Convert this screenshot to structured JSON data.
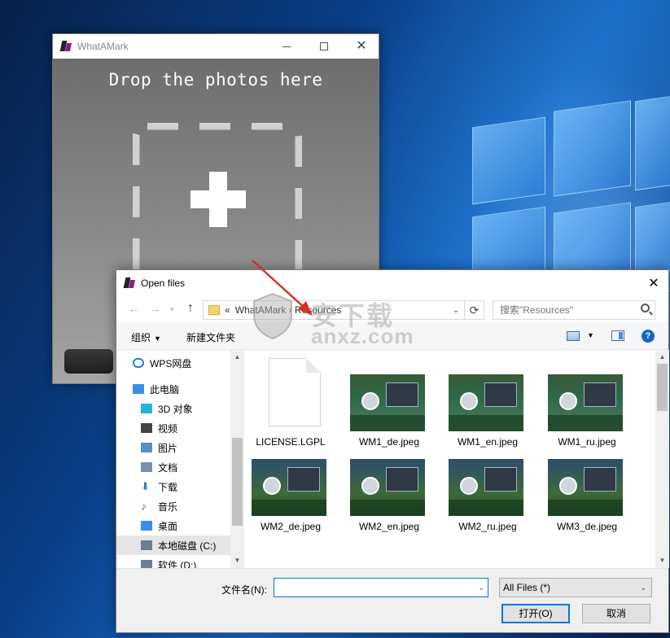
{
  "whatamark": {
    "title": "WhatAMark",
    "drop_label": "Drop the photos here"
  },
  "dialog": {
    "title": "Open files",
    "address": {
      "prefix": "«",
      "path": [
        "WhatAMark",
        "Resources"
      ],
      "path_text": "WhatAMark  ›  Resources"
    },
    "search_placeholder": "搜索\"Resources\"",
    "toolbar": {
      "organize": "组织",
      "new_folder": "新建文件夹"
    },
    "sidebar": [
      {
        "label": "WPS网盘",
        "icon": "cloud-icon"
      },
      {
        "label": "此电脑",
        "icon": "computer-icon"
      },
      {
        "label": "3D 对象",
        "icon": "3d-objects-icon"
      },
      {
        "label": "视频",
        "icon": "video-icon"
      },
      {
        "label": "图片",
        "icon": "pictures-icon"
      },
      {
        "label": "文档",
        "icon": "documents-icon"
      },
      {
        "label": "下载",
        "icon": "download-icon"
      },
      {
        "label": "音乐",
        "icon": "music-icon"
      },
      {
        "label": "桌面",
        "icon": "desktop-icon"
      },
      {
        "label": "本地磁盘 (C:)",
        "icon": "drive-icon",
        "selected": true
      },
      {
        "label": "软件 (D:)",
        "icon": "drive-icon"
      }
    ],
    "files": [
      {
        "name": "LICENSE.LGPL",
        "kind": "document"
      },
      {
        "name": "WM1_de.jpeg",
        "kind": "image"
      },
      {
        "name": "WM1_en.jpeg",
        "kind": "image"
      },
      {
        "name": "WM1_ru.jpeg",
        "kind": "image"
      },
      {
        "name": "WM2_de.jpeg",
        "kind": "image"
      },
      {
        "name": "WM2_en.jpeg",
        "kind": "image"
      },
      {
        "name": "WM2_ru.jpeg",
        "kind": "image"
      },
      {
        "name": "WM3_de.jpeg",
        "kind": "image"
      }
    ],
    "footer": {
      "filename_label": "文件名(N):",
      "filename_value": "",
      "filetype": "All Files  (*)",
      "open_button": "打开(O)",
      "cancel_button": "取消"
    }
  },
  "watermark": {
    "text": "安下载",
    "domain": "anxz.com"
  },
  "colors": {
    "accent": "#0078d7",
    "selected_bg": "#e5e5e5",
    "desktop_blue": "#0a3f86"
  }
}
